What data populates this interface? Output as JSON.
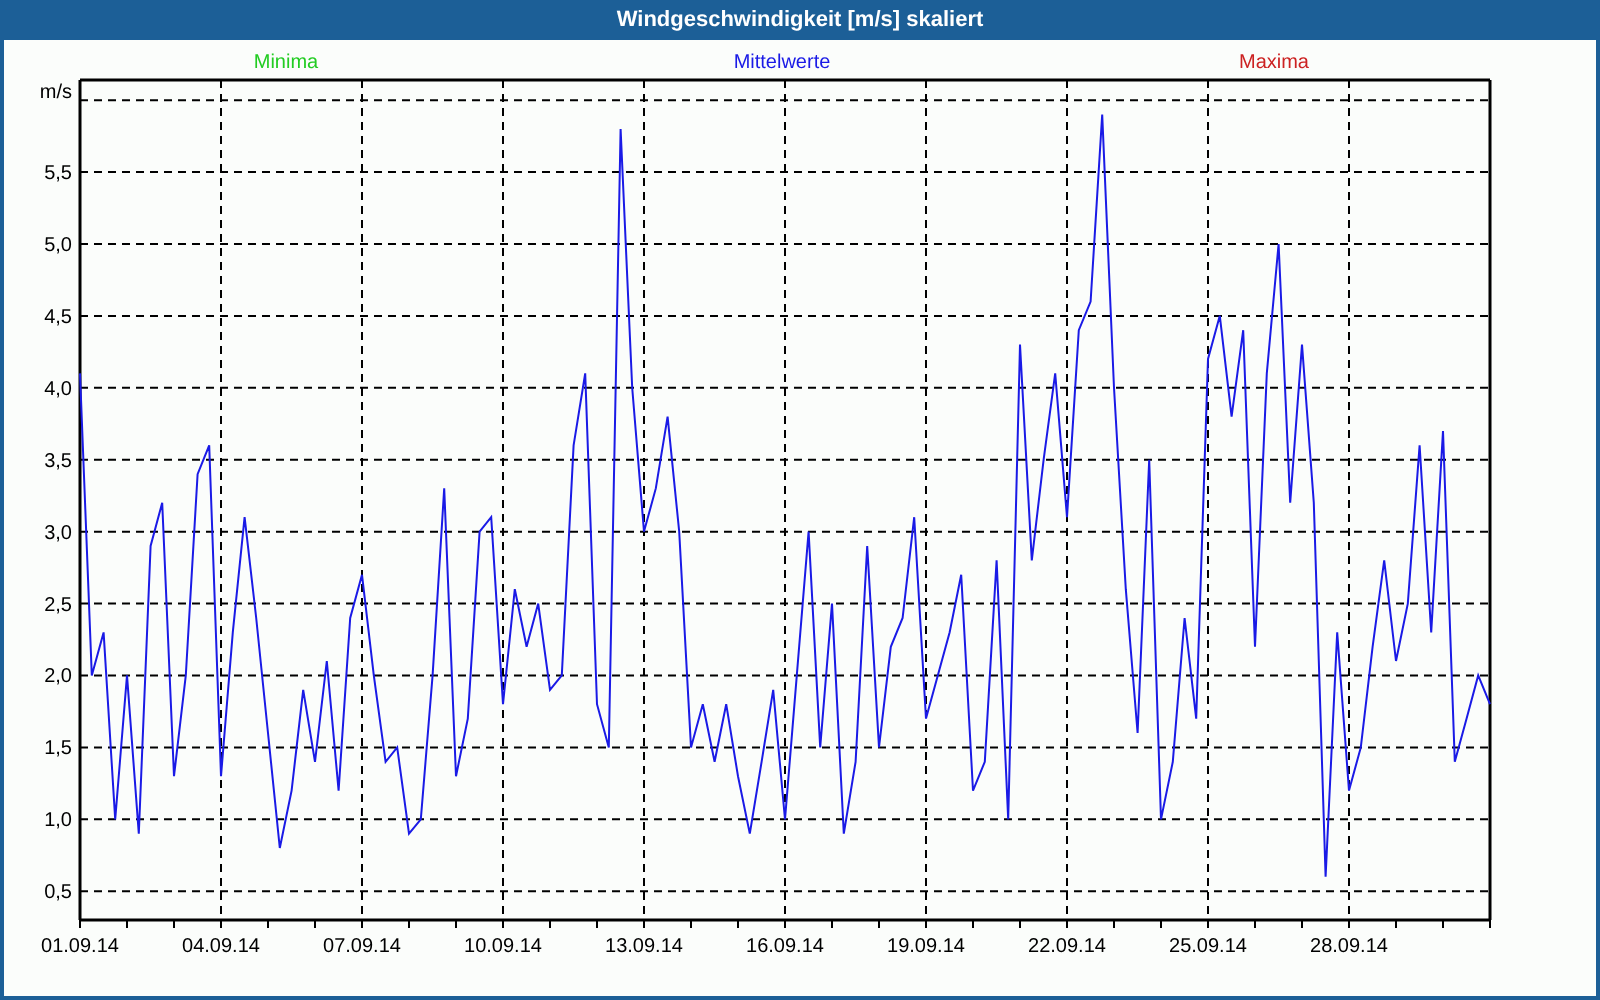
{
  "window": {
    "title": "Windgeschwindigkeit [m/s] skaliert"
  },
  "legend": [
    {
      "label": "Minima",
      "color": "#22cc22"
    },
    {
      "label": "Maxima",
      "color": "#cc2222"
    }
  ],
  "chart_data": {
    "type": "line",
    "grid": true,
    "ylabel": "m/s",
    "ylim": [
      0.3,
      6.14
    ],
    "yticks": [
      {
        "value": 0.5,
        "label": "0,5"
      },
      {
        "value": 1,
        "label": "1,0"
      },
      {
        "value": 1.5,
        "label": "1,5"
      },
      {
        "value": 2,
        "label": "2,0"
      },
      {
        "value": 2.5,
        "label": "2,5"
      },
      {
        "value": 3,
        "label": "3,0"
      },
      {
        "value": 3.5,
        "label": "3,5"
      },
      {
        "value": 4,
        "label": "4,0"
      },
      {
        "value": 4.5,
        "label": "4,5"
      },
      {
        "value": 5,
        "label": "5,0"
      },
      {
        "value": 5.5,
        "label": "5,5"
      }
    ],
    "categories": [
      "01.09.14",
      null,
      null,
      null,
      null,
      null,
      null,
      null,
      null,
      null,
      null,
      null,
      "04.09.14",
      null,
      null,
      null,
      null,
      null,
      null,
      null,
      null,
      null,
      null,
      null,
      "07.09.14",
      null,
      null,
      null,
      null,
      null,
      null,
      null,
      null,
      null,
      null,
      null,
      "10.09.14",
      null,
      null,
      null,
      null,
      null,
      null,
      null,
      null,
      null,
      null,
      null,
      "13.09.14",
      null,
      null,
      null,
      null,
      null,
      null,
      null,
      null,
      null,
      null,
      null,
      "16.09.14",
      null,
      null,
      null,
      null,
      null,
      null,
      null,
      null,
      null,
      null,
      null,
      "19.09.14",
      null,
      null,
      null,
      null,
      null,
      null,
      null,
      null,
      null,
      null,
      null,
      "22.09.14",
      null,
      null,
      null,
      null,
      null,
      null,
      null,
      null,
      null,
      null,
      null,
      "25.09.14",
      null,
      null,
      null,
      null,
      null,
      null,
      null,
      null,
      null,
      null,
      null,
      "28.09.14",
      null,
      null,
      null,
      null,
      null,
      null,
      null,
      null,
      null,
      null,
      null,
      null
    ],
    "series": [
      {
        "name": "Mittelwerte",
        "color": "#1a1ae6",
        "values": [
          4.1,
          2.0,
          2.3,
          1.0,
          2.0,
          0.9,
          2.9,
          3.2,
          1.3,
          2.0,
          3.4,
          3.6,
          1.3,
          2.3,
          3.1,
          2.4,
          1.6,
          0.8,
          1.2,
          1.9,
          1.4,
          2.1,
          1.2,
          2.4,
          2.7,
          2.0,
          1.4,
          1.5,
          0.9,
          1.0,
          2.0,
          3.3,
          1.3,
          1.7,
          3.0,
          3.1,
          1.8,
          2.6,
          2.2,
          2.5,
          1.9,
          2.0,
          3.6,
          4.1,
          1.8,
          1.5,
          5.8,
          4.0,
          3.0,
          3.3,
          3.8,
          3.0,
          1.5,
          1.8,
          1.4,
          1.8,
          1.3,
          0.9,
          1.4,
          1.9,
          1.0,
          2.0,
          3.0,
          1.5,
          2.5,
          0.9,
          1.4,
          2.9,
          1.5,
          2.2,
          2.4,
          3.1,
          1.7,
          2.0,
          2.3,
          2.7,
          1.2,
          1.4,
          2.8,
          1.0,
          4.3,
          2.8,
          3.5,
          4.1,
          3.1,
          4.4,
          4.6,
          5.9,
          4.0,
          2.6,
          1.6,
          3.5,
          1.0,
          1.4,
          2.4,
          1.7,
          4.2,
          4.5,
          3.8,
          4.4,
          2.2,
          4.1,
          5.0,
          3.2,
          4.3,
          3.2,
          0.6,
          2.3,
          1.2,
          1.5,
          2.2,
          2.8,
          2.1,
          2.5,
          3.6,
          2.3,
          3.7,
          1.4,
          1.7,
          2.0,
          1.8
        ]
      }
    ]
  }
}
